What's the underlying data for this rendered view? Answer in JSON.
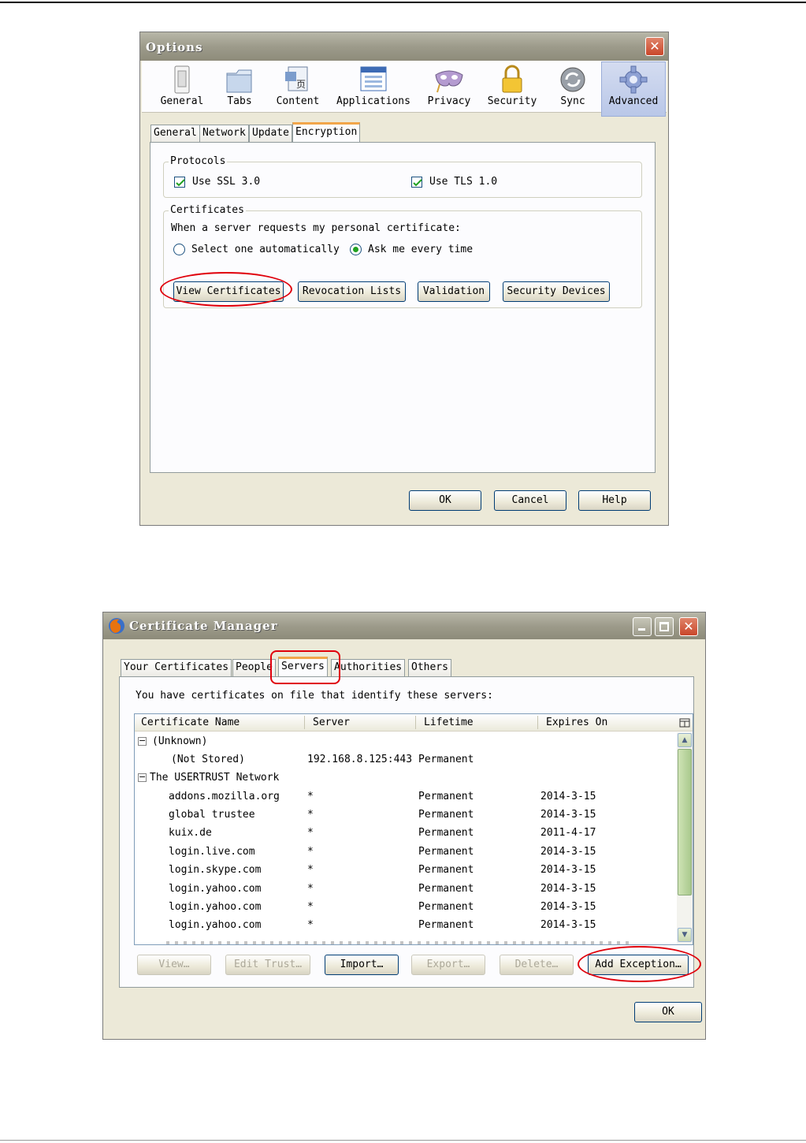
{
  "options_dialog": {
    "title": "Options",
    "toolbar": [
      {
        "label": "General",
        "icon": "light-switch-icon"
      },
      {
        "label": "Tabs",
        "icon": "folder-tab-icon"
      },
      {
        "label": "Content",
        "icon": "content-page-icon"
      },
      {
        "label": "Applications",
        "icon": "applications-window-icon"
      },
      {
        "label": "Privacy",
        "icon": "mask-icon"
      },
      {
        "label": "Security",
        "icon": "padlock-icon"
      },
      {
        "label": "Sync",
        "icon": "sync-arrows-icon"
      },
      {
        "label": "Advanced",
        "icon": "gear-icon"
      }
    ],
    "selected_toolbar": "Advanced",
    "subtabs": [
      "General",
      "Network",
      "Update",
      "Encryption"
    ],
    "active_subtab": "Encryption",
    "protocols": {
      "legend": "Protocols",
      "ssl_label": "Use SSL 3.0",
      "tls_label": "Use TLS 1.0"
    },
    "certificates": {
      "legend": "Certificates",
      "prompt": "When a server requests my personal certificate:",
      "radio_auto": "Select one automatically",
      "radio_ask": "Ask me every time"
    },
    "buttons": {
      "view_certificates": "View Certificates",
      "revocation_lists": "Revocation Lists",
      "validation": "Validation",
      "security_devices": "Security Devices",
      "ok": "OK",
      "cancel": "Cancel",
      "help": "Help"
    }
  },
  "cert_manager": {
    "title": "Certificate Manager",
    "tabs": [
      "Your Certificates",
      "People",
      "Servers",
      "Authorities",
      "Others"
    ],
    "active_tab": "Servers",
    "description": "You have certificates on file that identify these servers:",
    "columns": [
      "Certificate Name",
      "Server",
      "Lifetime",
      "Expires On"
    ],
    "groups": [
      {
        "name": "(Unknown)",
        "rows": [
          {
            "name": "(Not Stored)",
            "server": "192.168.8.125:443",
            "lifetime": "Permanent",
            "expires": ""
          }
        ]
      },
      {
        "name": "The USERTRUST Network",
        "rows": [
          {
            "name": "addons.mozilla.org",
            "server": "*",
            "lifetime": "Permanent",
            "expires": "2014-3-15"
          },
          {
            "name": "global trustee",
            "server": "*",
            "lifetime": "Permanent",
            "expires": "2014-3-15"
          },
          {
            "name": "kuix.de",
            "server": "*",
            "lifetime": "Permanent",
            "expires": "2011-4-17"
          },
          {
            "name": "login.live.com",
            "server": "*",
            "lifetime": "Permanent",
            "expires": "2014-3-15"
          },
          {
            "name": "login.skype.com",
            "server": "*",
            "lifetime": "Permanent",
            "expires": "2014-3-15"
          },
          {
            "name": "login.yahoo.com",
            "server": "*",
            "lifetime": "Permanent",
            "expires": "2014-3-15"
          },
          {
            "name": "login.yahoo.com",
            "server": "*",
            "lifetime": "Permanent",
            "expires": "2014-3-15"
          },
          {
            "name": "login.yahoo.com",
            "server": "*",
            "lifetime": "Permanent",
            "expires": "2014-3-15"
          }
        ]
      }
    ],
    "buttons": {
      "view": "View…",
      "edit_trust": "Edit Trust…",
      "import": "Import…",
      "export": "Export…",
      "delete": "Delete…",
      "add_exception": "Add Exception…",
      "ok": "OK"
    }
  }
}
